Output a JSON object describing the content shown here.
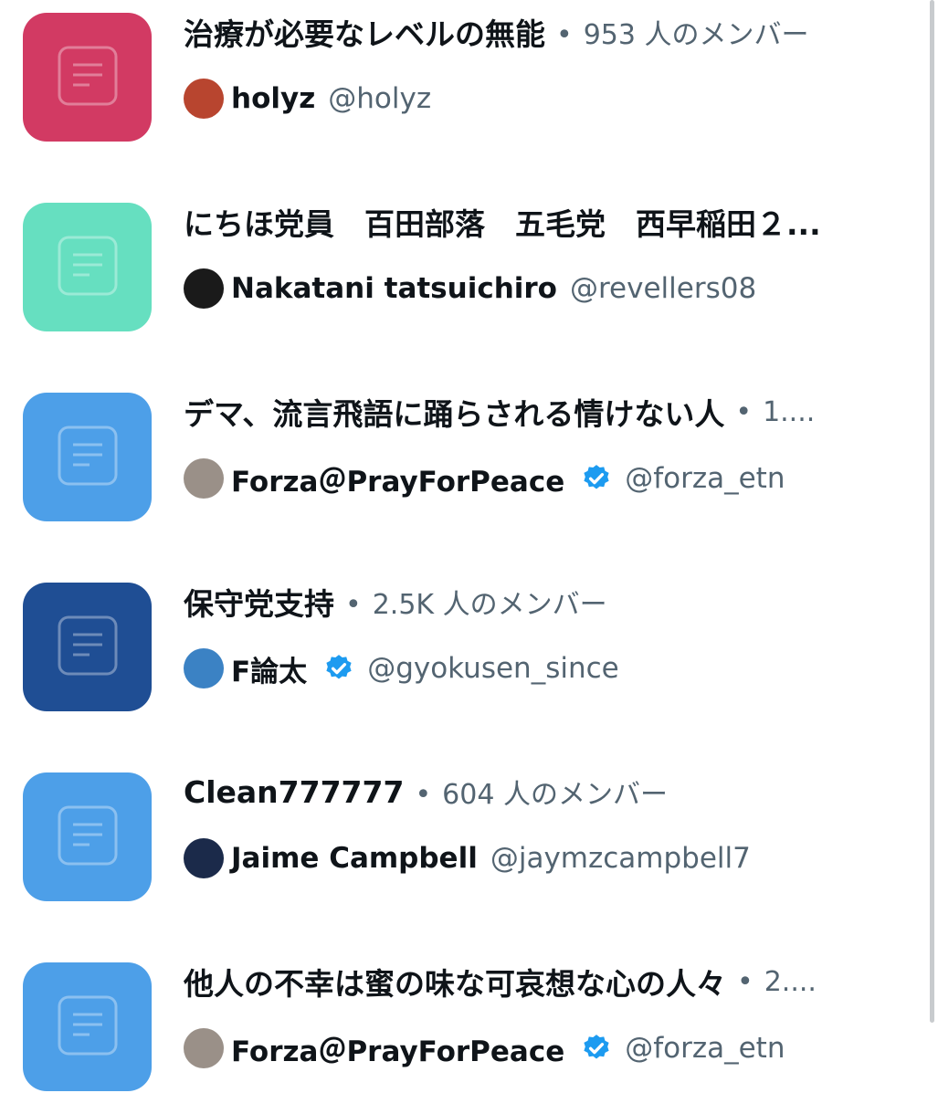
{
  "lists": [
    {
      "title": "治療が必要なレベルの無能",
      "separator": "•",
      "members": "953 人のメンバー",
      "tile_color": "#d23a63",
      "icon": "list-icon",
      "owner": {
        "name": "holyz",
        "handle": "@holyz",
        "verified": false,
        "avatar_color": "#b8452f"
      }
    },
    {
      "title": "にちほ党員　百田部落　五毛党　西早稲田２...",
      "separator": "",
      "members": "",
      "tile_color": "#66dfc0",
      "icon": "list-icon",
      "owner": {
        "name": "Nakatani tatsuichiro",
        "handle": "@revellers08",
        "verified": false,
        "avatar_color": "#1a1a1a"
      }
    },
    {
      "title": "デマ、流言飛語に踊らされる情けない人",
      "separator": "•",
      "members": "1....",
      "tile_color": "#4d9fe8",
      "icon": "list-icon",
      "owner": {
        "name": "Forza＠PrayForPeace",
        "handle": "@forza_etn",
        "verified": true,
        "avatar_color": "#9a9088"
      }
    },
    {
      "title": "保守党支持",
      "separator": "•",
      "members": "2.5K 人のメンバー",
      "tile_color": "#1f4e94",
      "icon": "list-icon",
      "owner": {
        "name": "F論太",
        "handle": "@gyokusen_since",
        "verified": true,
        "avatar_color": "#3b82c4"
      }
    },
    {
      "title": "Clean777777",
      "separator": "•",
      "members": "604 人のメンバー",
      "tile_color": "#4d9fe8",
      "icon": "list-icon",
      "owner": {
        "name": "Jaime Campbell",
        "handle": "@jaymzcampbell7",
        "verified": false,
        "avatar_color": "#1b2a4a"
      }
    },
    {
      "title": "他人の不幸は蜜の味な可哀想な心の人々",
      "separator": "•",
      "members": "2....",
      "tile_color": "#4d9fe8",
      "icon": "list-icon",
      "owner": {
        "name": "Forza＠PrayForPeace",
        "handle": "@forza_etn",
        "verified": true,
        "avatar_color": "#9a9088"
      }
    }
  ],
  "colors": {
    "verified": "#1d9bf0",
    "secondary_text": "#536471",
    "primary_text": "#0f1419"
  }
}
